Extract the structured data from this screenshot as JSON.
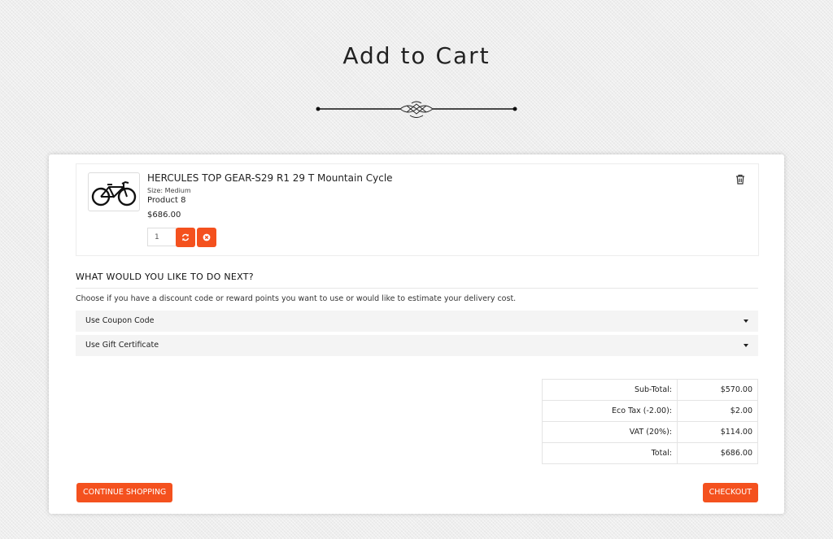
{
  "page": {
    "title": "Add to Cart"
  },
  "cart": {
    "item": {
      "name": "HERCULES TOP GEAR-S29 R1 29 T Mountain Cycle",
      "size": "Size: Medium",
      "model": "Product 8",
      "price": "$686.00",
      "quantity": "1",
      "image_icon": "bicycle-icon"
    },
    "actions": {
      "update_icon": "refresh-icon",
      "remove_icon": "close-circle-icon",
      "delete_icon": "trash-icon"
    }
  },
  "next_steps": {
    "heading": "WHAT WOULD YOU LIKE TO DO NEXT?",
    "description": "Choose if you have a discount code or reward points you want to use or would like to estimate your delivery cost.",
    "panels": [
      {
        "label": "Use Coupon Code"
      },
      {
        "label": "Use Gift Certificate"
      }
    ]
  },
  "totals": [
    {
      "label": "Sub-Total:",
      "value": "$570.00"
    },
    {
      "label": "Eco Tax (-2.00):",
      "value": "$2.00"
    },
    {
      "label": "VAT (20%):",
      "value": "$114.00"
    },
    {
      "label": "Total:",
      "value": "$686.00"
    }
  ],
  "buttons": {
    "continue": "CONTINUE SHOPPING",
    "checkout": "CHECKOUT"
  },
  "colors": {
    "accent": "#f4511e",
    "panel_bg": "#f4f4f4",
    "page_bg": "#eeeeee"
  }
}
